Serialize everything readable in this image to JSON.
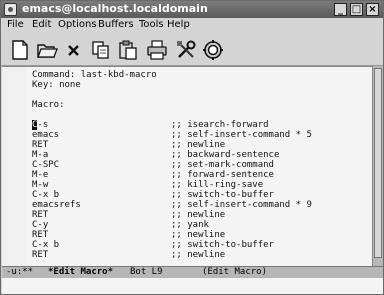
{
  "window": {
    "title": "emacs@localhost.localdomain",
    "controls": [
      "_",
      "□",
      "×"
    ]
  },
  "menu": [
    "File",
    "Edit",
    "Options",
    "Buffers",
    "Tools",
    "Help"
  ],
  "toolbar": [
    "new-file",
    "open-folder",
    "close",
    "copy",
    "paste",
    "print",
    "tools",
    "settings"
  ],
  "buffer": {
    "header_command": "Command: last-kbd-macro",
    "header_key": "Key: none",
    "macro_label": "Macro:",
    "macro_lines": [
      {
        "key": "C-s",
        "comment": ";; isearch-forward"
      },
      {
        "key": "emacs",
        "comment": ";; self-insert-command * 5"
      },
      {
        "key": "RET",
        "comment": ";; newline"
      },
      {
        "key": "M-a",
        "comment": ";; backward-sentence"
      },
      {
        "key": "C-SPC",
        "comment": ";; set-mark-command"
      },
      {
        "key": "M-e",
        "comment": ";; forward-sentence"
      },
      {
        "key": "M-w",
        "comment": ";; kill-ring-save"
      },
      {
        "key": "C-x b",
        "comment": ";; switch-to-buffer"
      },
      {
        "key": "emacsrefs",
        "comment": ";; self-insert-command * 9"
      },
      {
        "key": "RET",
        "comment": ";; newline"
      },
      {
        "key": "C-y",
        "comment": ";; yank"
      },
      {
        "key": "RET",
        "comment": ";; newline"
      },
      {
        "key": "C-x b",
        "comment": ";; switch-to-buffer"
      },
      {
        "key": "RET",
        "comment": ";; newline"
      }
    ]
  },
  "modeline": {
    "status": "-u:**",
    "buffer_name": "*Edit Macro*",
    "position": "Bot L9",
    "mode": "(Edit Macro)"
  }
}
